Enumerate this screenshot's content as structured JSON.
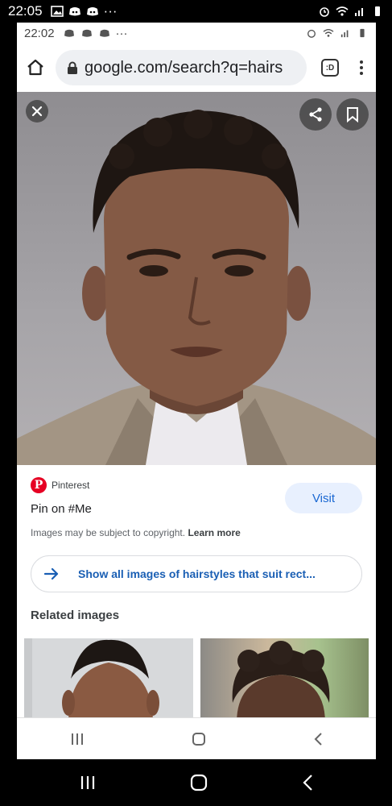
{
  "outer_status": {
    "time": "22:05",
    "more": "···"
  },
  "inner_status": {
    "time": "22:02",
    "more": "···"
  },
  "browser": {
    "url": "google.com/search?q=hairs",
    "tabs_count": ":D"
  },
  "image_viewer": {
    "source_name": "Pinterest",
    "title": "Pin on #Me",
    "visit_label": "Visit",
    "copyright_text": "Images may be subject to copyright.",
    "learn_more": "Learn more",
    "show_all_label": "Show all images of hairstyles that suit rect...",
    "related_title": "Related images"
  },
  "colors": {
    "pinterest_red": "#e60023",
    "link_blue": "#1a5fb4",
    "visit_bg": "#e8f0fe"
  },
  "icons": {
    "home": "home-icon",
    "lock": "lock-icon",
    "close": "close-icon",
    "share": "share-icon",
    "bookmark": "bookmark-icon",
    "arrow": "arrow-right-icon",
    "recent_apps": "recent-apps-icon",
    "home_nav": "home-nav-icon",
    "back": "back-icon"
  }
}
